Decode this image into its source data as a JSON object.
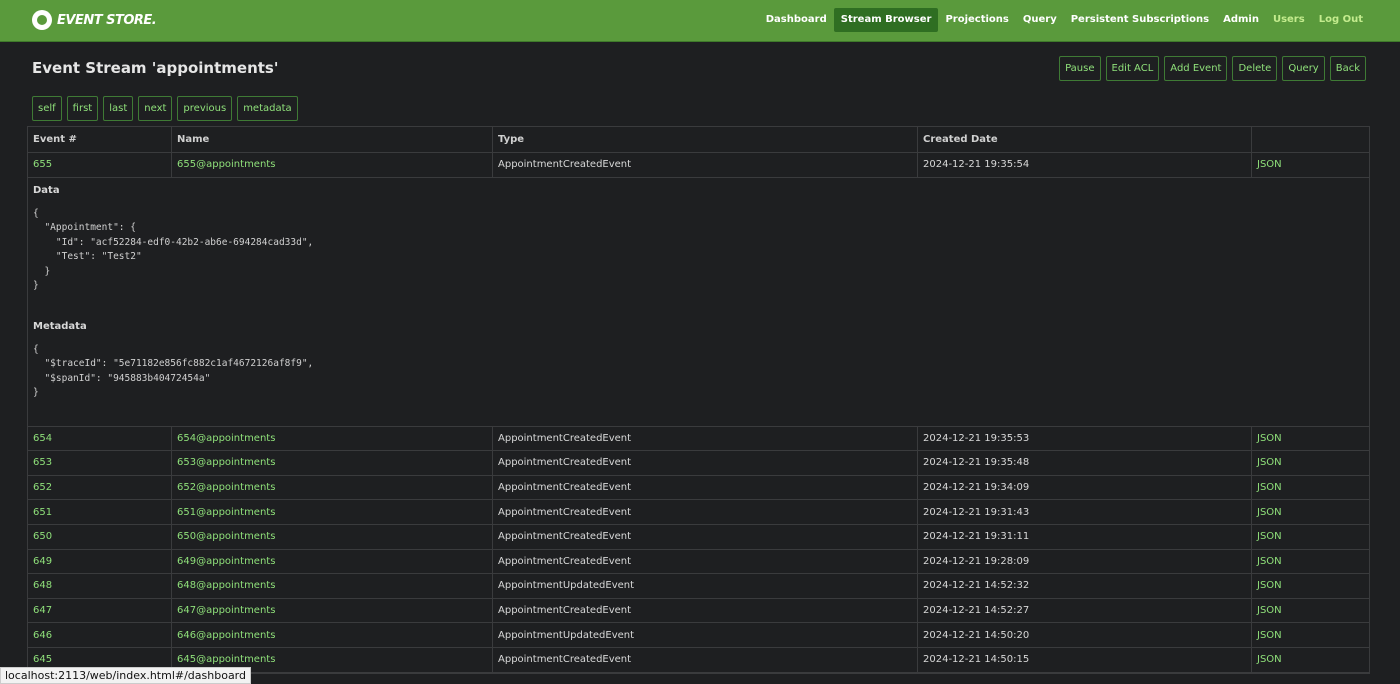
{
  "brand": {
    "name": "EVENT STORE."
  },
  "nav": [
    {
      "label": "Dashboard",
      "active": false
    },
    {
      "label": "Stream Browser",
      "active": true
    },
    {
      "label": "Projections",
      "active": false
    },
    {
      "label": "Query",
      "active": false
    },
    {
      "label": "Persistent Subscriptions",
      "active": false
    },
    {
      "label": "Admin",
      "active": false
    },
    {
      "label": "Users",
      "active": false
    },
    {
      "label": "Log Out",
      "active": false
    }
  ],
  "page": {
    "title": "Event Stream 'appointments'"
  },
  "actions": [
    "Pause",
    "Edit ACL",
    "Add Event",
    "Delete",
    "Query",
    "Back"
  ],
  "links": [
    "self",
    "first",
    "last",
    "next",
    "previous",
    "metadata"
  ],
  "table": {
    "headers": [
      "Event #",
      "Name",
      "Type",
      "Created Date",
      ""
    ],
    "expanded": {
      "data_label": "Data",
      "data_json": "{\n  \"Appointment\": {\n    \"Id\": \"acf52284-edf0-42b2-ab6e-694284cad33d\",\n    \"Test\": \"Test2\"\n  }\n}",
      "metadata_label": "Metadata",
      "metadata_json": "{\n  \"$traceId\": \"5e71182e856fc882c1af4672126af8f9\",\n  \"$spanId\": \"945883b40472454a\"\n}"
    },
    "rows": [
      {
        "num": "655",
        "name": "655@appointments",
        "type": "AppointmentCreatedEvent",
        "date": "2024-12-21 19:35:54",
        "link": "JSON"
      },
      {
        "num": "654",
        "name": "654@appointments",
        "type": "AppointmentCreatedEvent",
        "date": "2024-12-21 19:35:53",
        "link": "JSON"
      },
      {
        "num": "653",
        "name": "653@appointments",
        "type": "AppointmentCreatedEvent",
        "date": "2024-12-21 19:35:48",
        "link": "JSON"
      },
      {
        "num": "652",
        "name": "652@appointments",
        "type": "AppointmentCreatedEvent",
        "date": "2024-12-21 19:34:09",
        "link": "JSON"
      },
      {
        "num": "651",
        "name": "651@appointments",
        "type": "AppointmentCreatedEvent",
        "date": "2024-12-21 19:31:43",
        "link": "JSON"
      },
      {
        "num": "650",
        "name": "650@appointments",
        "type": "AppointmentCreatedEvent",
        "date": "2024-12-21 19:31:11",
        "link": "JSON"
      },
      {
        "num": "649",
        "name": "649@appointments",
        "type": "AppointmentCreatedEvent",
        "date": "2024-12-21 19:28:09",
        "link": "JSON"
      },
      {
        "num": "648",
        "name": "648@appointments",
        "type": "AppointmentUpdatedEvent",
        "date": "2024-12-21 14:52:32",
        "link": "JSON"
      },
      {
        "num": "647",
        "name": "647@appointments",
        "type": "AppointmentCreatedEvent",
        "date": "2024-12-21 14:52:27",
        "link": "JSON"
      },
      {
        "num": "646",
        "name": "646@appointments",
        "type": "AppointmentUpdatedEvent",
        "date": "2024-12-21 14:50:20",
        "link": "JSON"
      },
      {
        "num": "645",
        "name": "645@appointments",
        "type": "AppointmentCreatedEvent",
        "date": "2024-12-21 14:50:15",
        "link": "JSON"
      }
    ]
  },
  "status_bar": {
    "url": "localhost:2113/web/index.html#/dashboard"
  },
  "colors": {
    "header_bg": "#5a9a3c",
    "accent": "#8fe07a",
    "background": "#1e1f21"
  }
}
